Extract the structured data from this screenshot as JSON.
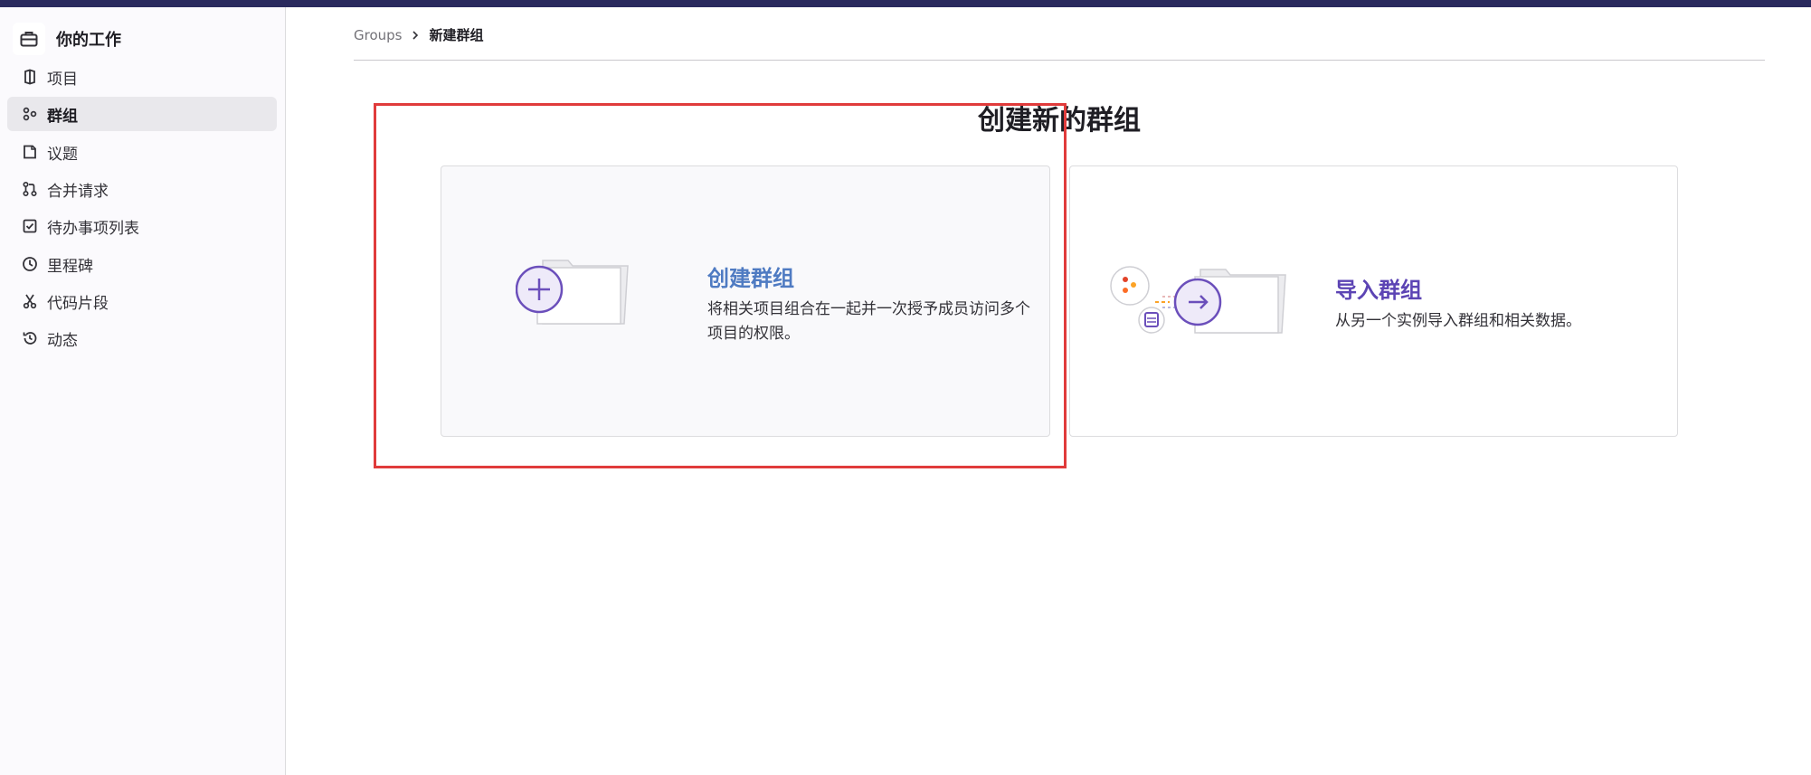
{
  "sidebar": {
    "title": "你的工作",
    "title_icon": "briefcase-icon",
    "items": [
      {
        "label": "项目",
        "icon": "project-icon",
        "active": false
      },
      {
        "label": "群组",
        "icon": "group-icon",
        "active": true
      },
      {
        "label": "议题",
        "icon": "issues-icon",
        "active": false
      },
      {
        "label": "合并请求",
        "icon": "merge-request-icon",
        "active": false
      },
      {
        "label": "待办事项列表",
        "icon": "todo-icon",
        "active": false
      },
      {
        "label": "里程碑",
        "icon": "clock-icon",
        "active": false
      },
      {
        "label": "代码片段",
        "icon": "scissors-icon",
        "active": false
      },
      {
        "label": "动态",
        "icon": "history-icon",
        "active": false
      }
    ]
  },
  "breadcrumb": {
    "parent": "Groups",
    "current": "新建群组"
  },
  "page": {
    "title": "创建新的群组"
  },
  "cards": {
    "create": {
      "title": "创建群组",
      "description": "将相关项目组合在一起并一次授予成员访问多个项目的权限。"
    },
    "import": {
      "title": "导入群组",
      "description": "从另一个实例导入群组和相关数据。"
    }
  },
  "colors": {
    "topbar": "#2a2a5e",
    "highlight": "#e03b3b",
    "create_title": "#4f7bc2",
    "import_title": "#5c44b4",
    "accent_purple": "#6b4fbb"
  }
}
